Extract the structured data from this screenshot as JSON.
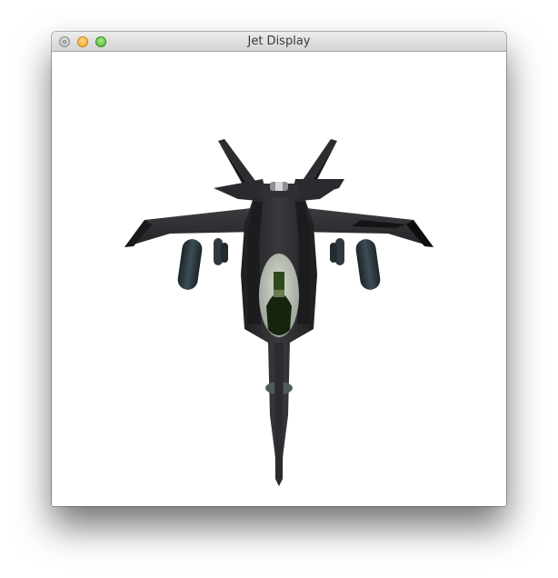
{
  "window": {
    "title": "Jet Display",
    "controls": {
      "close": "close-icon",
      "minimize": "minimize-icon",
      "zoom": "zoom-icon"
    }
  },
  "scene": {
    "subject": "fighter-jet-3d-model",
    "colors": {
      "body": "#2b2b2e",
      "canopy": "#b9c0b5",
      "cockpit": "#0f1c0a",
      "intake": "#4d5b5b"
    }
  }
}
